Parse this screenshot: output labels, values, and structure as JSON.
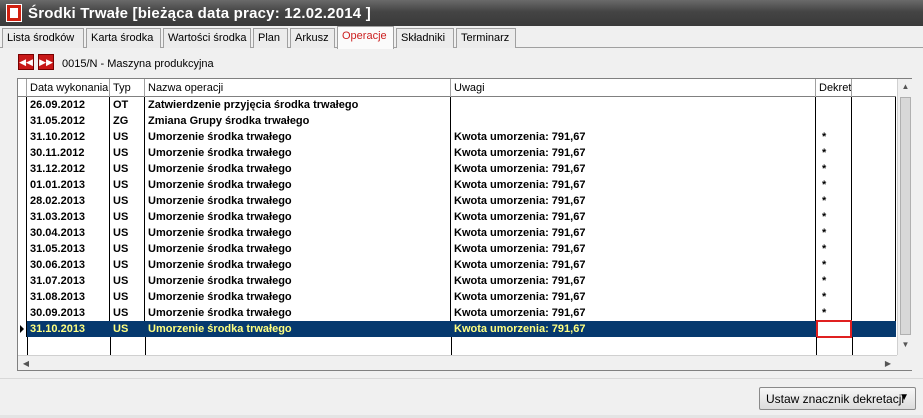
{
  "window": {
    "title": "Środki Trwałe  [bieżąca data pracy: 12.02.2014 ]",
    "icon": "app-book-icon"
  },
  "tabs": [
    {
      "label": "Lista środków",
      "active": false
    },
    {
      "label": "Karta środka",
      "active": false
    },
    {
      "label": "Wartości środka",
      "active": false
    },
    {
      "label": "Plan",
      "active": false
    },
    {
      "label": "Arkusz",
      "active": false
    },
    {
      "label": "Operacje",
      "active": true
    },
    {
      "label": "Składniki",
      "active": false
    },
    {
      "label": "Terminarz",
      "active": false
    }
  ],
  "nav": {
    "prev_icon": "rewind-icon",
    "next_icon": "forward-icon",
    "prev_glyph": "◀◀",
    "next_glyph": "▶▶",
    "record_label": "0015/N - Maszyna produkcyjna"
  },
  "grid": {
    "columns": [
      "Data wykonania",
      "Typ",
      "Nazwa operacji",
      "Uwagi",
      "Dekret"
    ],
    "rows": [
      {
        "date": "26.09.2012",
        "type": "OT",
        "name": "Zatwierdzenie przyjęcia środka trwałego",
        "notes": "",
        "dekret": ""
      },
      {
        "date": "31.05.2012",
        "type": "ZG",
        "name": "Zmiana Grupy środka trwałego",
        "notes": "",
        "dekret": ""
      },
      {
        "date": "31.10.2012",
        "type": "US",
        "name": "Umorzenie środka trwałego",
        "notes": "Kwota umorzenia: 791,67",
        "dekret": "*"
      },
      {
        "date": "30.11.2012",
        "type": "US",
        "name": "Umorzenie środka trwałego",
        "notes": "Kwota umorzenia: 791,67",
        "dekret": "*"
      },
      {
        "date": "31.12.2012",
        "type": "US",
        "name": "Umorzenie środka trwałego",
        "notes": "Kwota umorzenia: 791,67",
        "dekret": "*"
      },
      {
        "date": "01.01.2013",
        "type": "US",
        "name": "Umorzenie środka trwałego",
        "notes": "Kwota umorzenia: 791,67",
        "dekret": "*"
      },
      {
        "date": "28.02.2013",
        "type": "US",
        "name": "Umorzenie środka trwałego",
        "notes": "Kwota umorzenia: 791,67",
        "dekret": "*"
      },
      {
        "date": "31.03.2013",
        "type": "US",
        "name": "Umorzenie środka trwałego",
        "notes": "Kwota umorzenia: 791,67",
        "dekret": "*"
      },
      {
        "date": "30.04.2013",
        "type": "US",
        "name": "Umorzenie środka trwałego",
        "notes": "Kwota umorzenia: 791,67",
        "dekret": "*"
      },
      {
        "date": "31.05.2013",
        "type": "US",
        "name": "Umorzenie środka trwałego",
        "notes": "Kwota umorzenia: 791,67",
        "dekret": "*"
      },
      {
        "date": "30.06.2013",
        "type": "US",
        "name": "Umorzenie środka trwałego",
        "notes": "Kwota umorzenia: 791,67",
        "dekret": "*"
      },
      {
        "date": "31.07.2013",
        "type": "US",
        "name": "Umorzenie środka trwałego",
        "notes": "Kwota umorzenia: 791,67",
        "dekret": "*"
      },
      {
        "date": "31.08.2013",
        "type": "US",
        "name": "Umorzenie środka trwałego",
        "notes": "Kwota umorzenia: 791,67",
        "dekret": "*"
      },
      {
        "date": "30.09.2013",
        "type": "US",
        "name": "Umorzenie środka trwałego",
        "notes": "Kwota umorzenia: 791,67",
        "dekret": "*"
      },
      {
        "date": "31.10.2013",
        "type": "US",
        "name": "Umorzenie środka trwałego",
        "notes": "Kwota umorzenia: 791,67",
        "dekret": "",
        "selected": true
      }
    ]
  },
  "scrollbar": {
    "up_glyph": "▲",
    "down_glyph": "▼",
    "left_glyph": "◀",
    "right_glyph": "▶"
  },
  "footer": {
    "button_label": "Ustaw znacznik dekretacji",
    "button_arrow": "▼"
  },
  "colors": {
    "selected_row_bg": "#06396e",
    "selected_row_text": "#ffff80",
    "active_tab_text": "#cc2020",
    "highlight_border": "#e02020"
  }
}
